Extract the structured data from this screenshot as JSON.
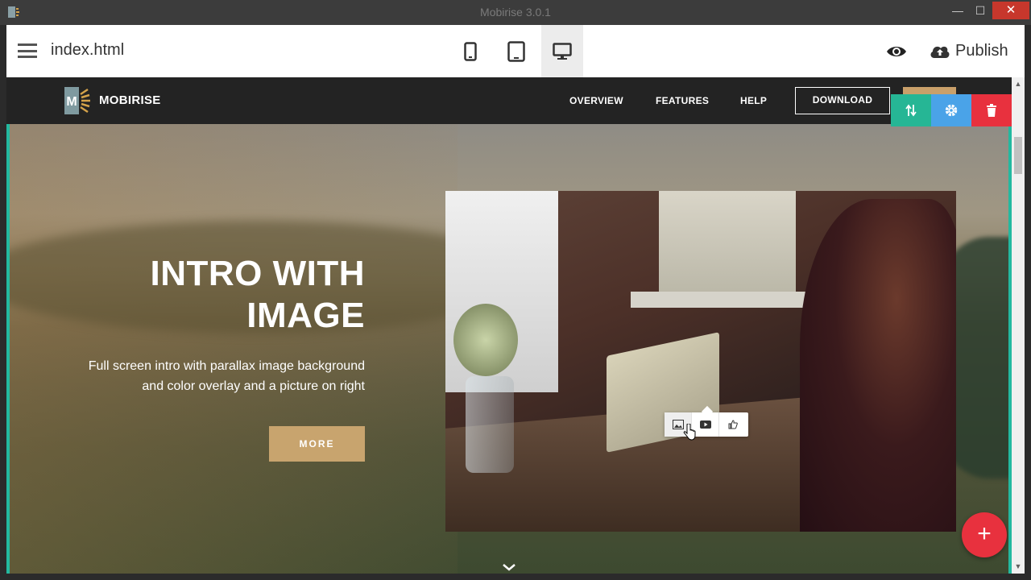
{
  "window": {
    "title": "Mobirise 3.0.1",
    "close_glyph": "✕",
    "min_glyph": "—",
    "max_glyph": "☐"
  },
  "toolbar": {
    "filename": "index.html",
    "devices": [
      "mobile-view",
      "tablet-view",
      "desktop-view"
    ],
    "active_device": "desktop-view",
    "publish_label": "Publish"
  },
  "site": {
    "brand": "MOBIRISE",
    "logo_letter": "M",
    "nav": [
      "OVERVIEW",
      "FEATURES",
      "HELP"
    ],
    "download_label": "DOWNLOAD"
  },
  "block_tools": {
    "colors": {
      "move": "#26b695",
      "settings": "#4aa3e8",
      "delete": "#e8313e"
    }
  },
  "hero": {
    "title_line1": "INTRO WITH",
    "title_line2": "IMAGE",
    "description_line1": "Full screen intro with parallax image background",
    "description_line2": "and color overlay and a picture on right",
    "button_label": "MORE"
  },
  "add_block_label": "+",
  "colors": {
    "accent": "#23b9a0",
    "button": "#c8a46e",
    "fab": "#e8313e"
  }
}
